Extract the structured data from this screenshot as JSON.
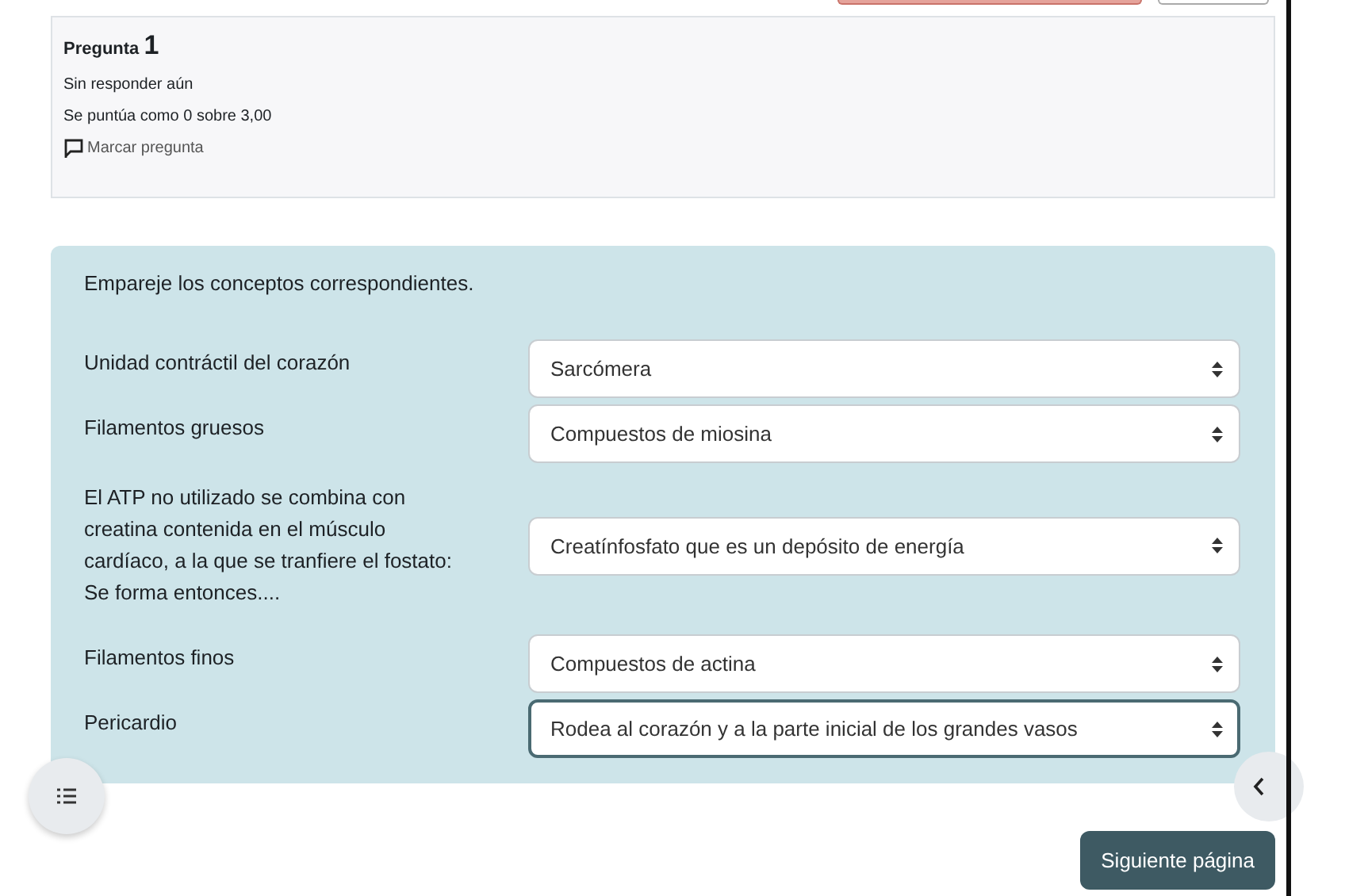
{
  "question_info": {
    "label": "Pregunta",
    "number": "1",
    "status": "Sin responder aún",
    "grade": "Se puntúa como 0 sobre 3,00",
    "flag_link": "Marcar pregunta"
  },
  "question": {
    "prompt": "Empareje los conceptos correspondientes.",
    "rows": [
      {
        "concept": "Unidad contráctil del corazón",
        "answer": "Sarcómera",
        "focused": false
      },
      {
        "concept": "Filamentos gruesos",
        "answer": "Compuestos de miosina",
        "focused": false
      },
      {
        "concept": "El ATP no utilizado se combina con creatina contenida en el músculo cardíaco, a la que se tranfiere el fostato: Se forma entonces....",
        "answer": "Creatínfosfato que es un depósito de energía",
        "focused": false
      },
      {
        "concept": "Filamentos finos",
        "answer": "Compuestos de actina",
        "focused": false
      },
      {
        "concept": "Pericardio",
        "answer": "Rodea al corazón y a la parte inicial de los grandes vasos",
        "focused": true
      }
    ]
  },
  "next_button": "Siguiente página"
}
